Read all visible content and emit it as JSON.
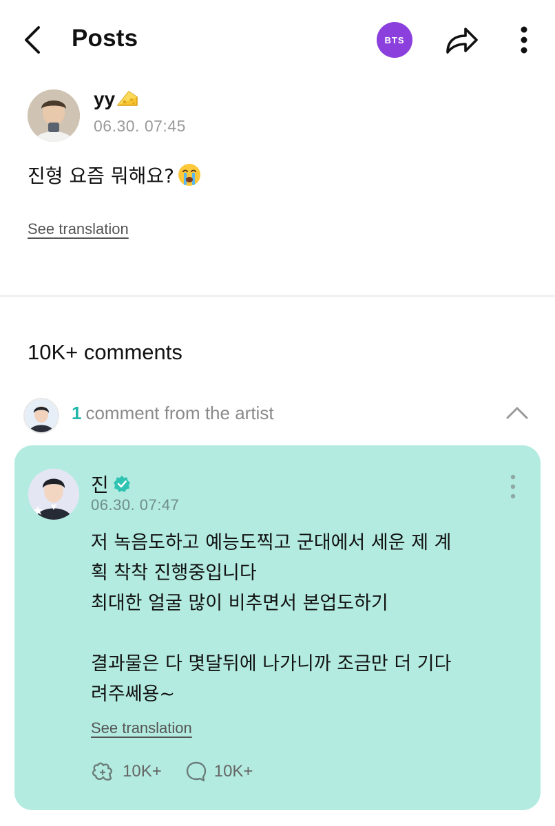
{
  "header": {
    "title": "Posts",
    "group_badge": "BTS",
    "icons": {
      "back": "back-arrow-icon",
      "share": "share-icon",
      "more": "more-vertical-icon"
    }
  },
  "post": {
    "author": "yy",
    "author_emoji": "cheese-icon",
    "timestamp": "06.30. 07:45",
    "text": "진형 요즘 뭐해요?",
    "text_emoji": "crying-face-icon",
    "see_translation": "See translation"
  },
  "comments": {
    "count_label": "10K+ comments",
    "artist_summary": {
      "count": "1",
      "label": "comment from the artist"
    },
    "artist_comment": {
      "author": "진",
      "verified": true,
      "timestamp": "06.30. 07:47",
      "lines": [
        "저 녹음도하고 예능도찍고 군대에서 세운 제 계",
        "획 착착 진행중입니다",
        "최대한 얼굴 많이 비추면서 본업도하기",
        "",
        "결과물은 다 몇달뒤에 나가니까 조금만 더 기다",
        "려주쎄용~"
      ],
      "see_translation": "See translation",
      "likes": "10K+",
      "replies": "10K+"
    }
  },
  "colors": {
    "accent_teal": "#1fb5a8",
    "card_bg": "#b3ebe0",
    "bts_purple": "#8b3fdc",
    "verified": "#2fc4b2"
  }
}
